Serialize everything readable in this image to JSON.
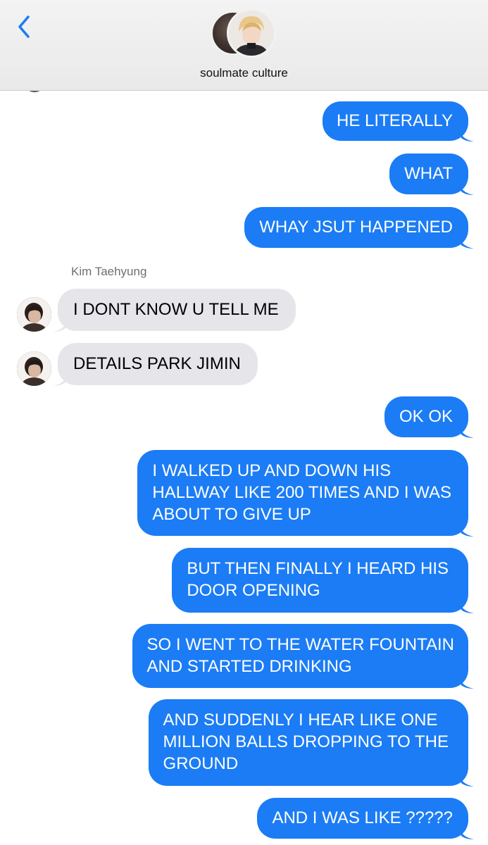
{
  "header": {
    "back_icon": "chevron-left-icon",
    "chat_name": "soulmate culture",
    "accent": "#1b7cf5"
  },
  "sender_name": "Kim Taehyung",
  "messages": [
    {
      "dir": "out",
      "text": "HE LITERALLY"
    },
    {
      "dir": "out",
      "text": "WHAT"
    },
    {
      "dir": "out",
      "text": "WHAY JSUT HAPPENED"
    },
    {
      "dir": "in",
      "sender": "Kim Taehyung",
      "text": "I DONT KNOW U TELL ME"
    },
    {
      "dir": "in",
      "sender": "Kim Taehyung",
      "text": "DETAILS PARK JIMIN"
    },
    {
      "dir": "out",
      "text": "OK OK"
    },
    {
      "dir": "out",
      "lines": [
        "I WALKED UP AND DOWN HIS",
        "HALLWAY LIKE 200 TIMES AND I WAS",
        "ABOUT TO GIVE UP"
      ]
    },
    {
      "dir": "out",
      "lines": [
        "BUT THEN FINALLY I HEARD HIS",
        "DOOR OPENING"
      ]
    },
    {
      "dir": "out",
      "lines": [
        "SO I WENT TO THE WATER FOUNTAIN",
        "AND STARTED DRINKING"
      ]
    },
    {
      "dir": "out",
      "lines": [
        "AND SUDDENLY I HEAR LIKE ONE",
        "MILLION BALLS DROPPING TO THE",
        "GROUND"
      ]
    },
    {
      "dir": "out",
      "text": "AND I WAS LIKE ?????"
    }
  ],
  "colors": {
    "outgoing_bubble": "#1b7cf5",
    "incoming_bubble": "#e6e5ea"
  }
}
